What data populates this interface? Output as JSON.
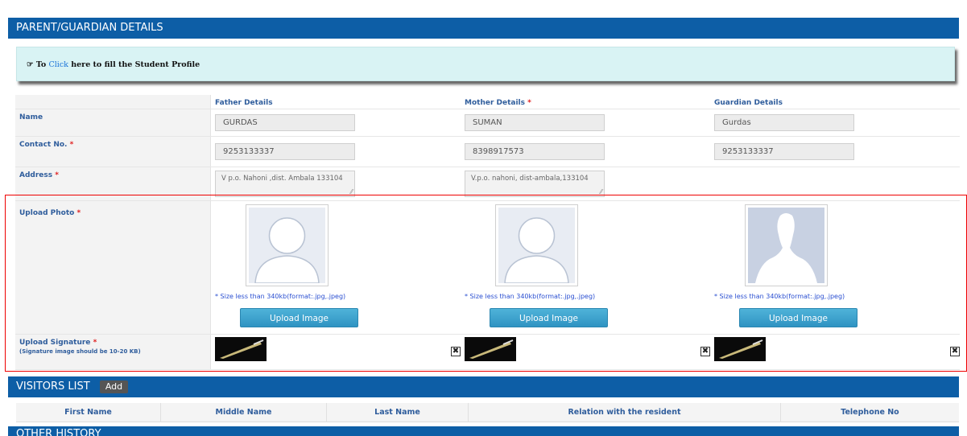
{
  "parent_section": {
    "title": "PARENT/GUARDIAN DETAILS",
    "notice": {
      "prefix": "To",
      "link": "Click",
      "suffix": "here to fill the Student Profile",
      "icon": "pointing-hand-icon"
    },
    "columns": {
      "father": "Father Details",
      "mother": "Mother Details",
      "guardian": "Guardian Details"
    },
    "rows": {
      "name": {
        "label": "Name",
        "father": "GURDAS",
        "mother": "SUMAN",
        "guardian": "Gurdas"
      },
      "contact": {
        "label": "Contact No.",
        "father": "9253133337",
        "mother": "8398917573",
        "guardian": "9253133337"
      },
      "address": {
        "label": "Address",
        "father": "V p.o. Nahoni ,dist. Ambala 133104",
        "mother": "V.p.o. nahoni, dist-ambala,133104"
      },
      "photo": {
        "label": "Upload Photo",
        "size_note": "* Size less than 340kb(format:.jpg,.jpeg)",
        "button": "Upload Image"
      },
      "signature": {
        "label": "Upload Signature",
        "note": "(Signature image should be 10-20 KB)",
        "remove": "✖"
      }
    },
    "required_mark": "*"
  },
  "visitors_section": {
    "title": "VISITORS LIST",
    "add_label": "Add",
    "columns": [
      "First Name",
      "Middle Name",
      "Last Name",
      "Relation with the resident",
      "Telephone No"
    ]
  },
  "other_section": {
    "title": "OTHER HISTORY"
  },
  "colors": {
    "header": "#0d5ea6",
    "notice_bg": "#d9f3f4",
    "label": "#2f5d9c",
    "highlight": "#e00000",
    "button": "#2f93c2"
  }
}
